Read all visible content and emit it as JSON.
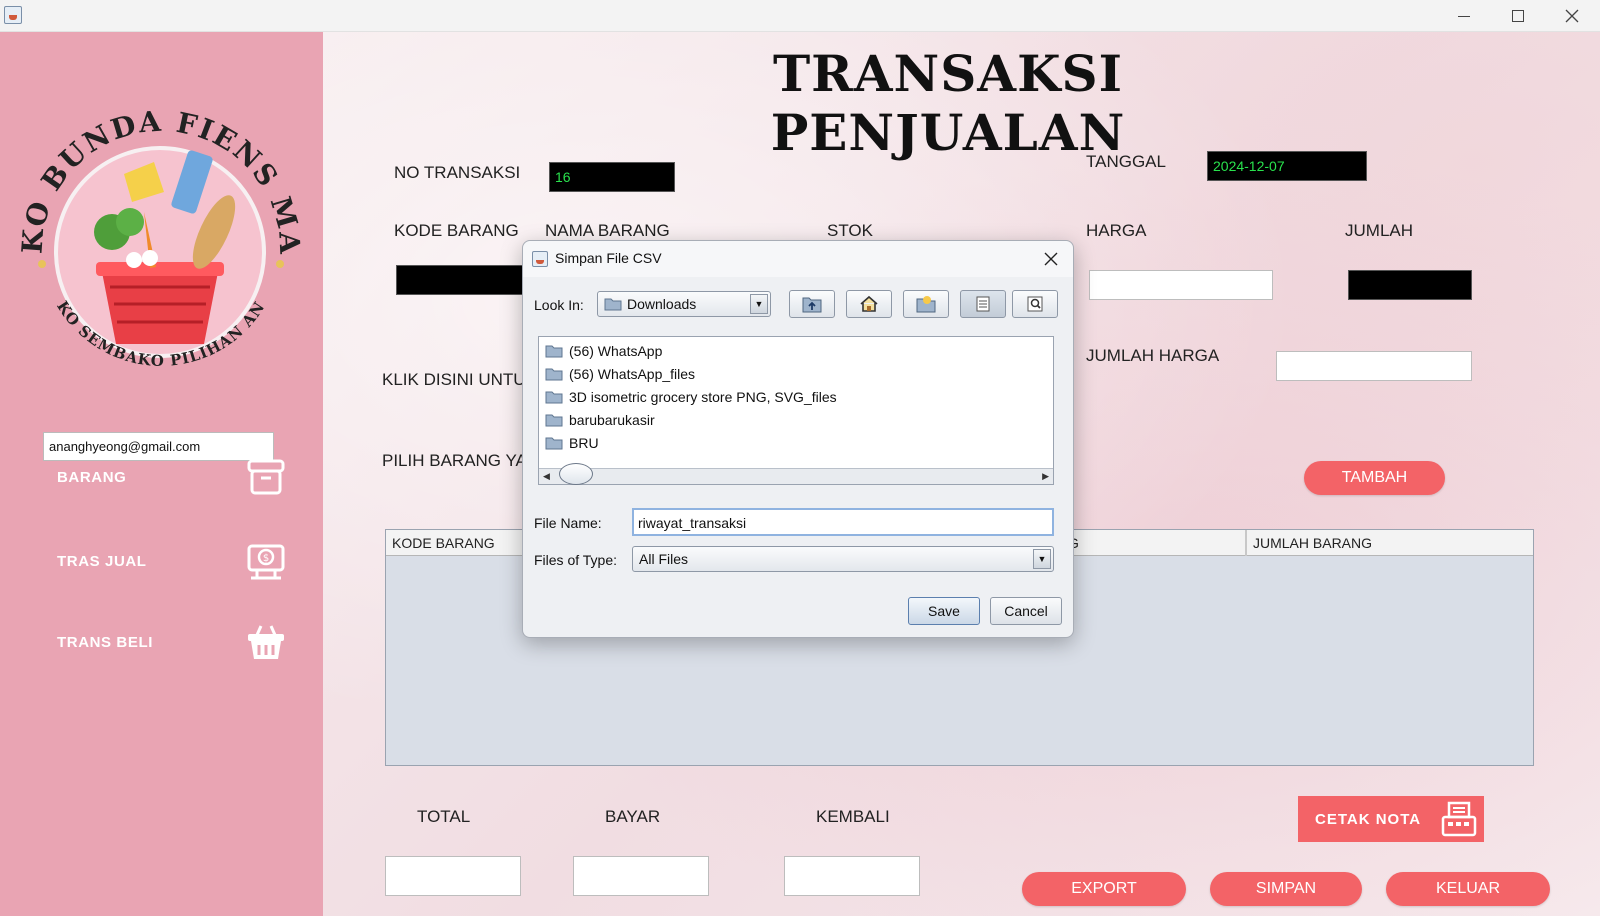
{
  "window": {
    "title": ""
  },
  "sidebar": {
    "logo": {
      "arc_top": "TOKO BUNDA FIENS MART",
      "arc_bottom": "TOKO SEMBAKO PILIHAN ANDA"
    },
    "email": "ananghyeong@gmail.com",
    "items": [
      {
        "label": "BARANG",
        "icon": "archive-box-icon"
      },
      {
        "label": "TRAS JUAL",
        "icon": "cash-register-icon"
      },
      {
        "label": "TRANS BELI",
        "icon": "shopping-basket-icon"
      }
    ]
  },
  "main": {
    "title": "TRANSAKSI PENJUALAN",
    "no_transaksi": {
      "label": "NO TRANSAKSI",
      "value": "16"
    },
    "tanggal": {
      "label": "TANGGAL",
      "value": "2024-12-07"
    },
    "kode_barang": {
      "label": "KODE BARANG",
      "value": ""
    },
    "nama_barang": {
      "label": "NAMA BARANG"
    },
    "stok": {
      "label": "STOK"
    },
    "harga": {
      "label": "HARGA",
      "value": ""
    },
    "jumlah": {
      "label": "JUMLAH",
      "value": ""
    },
    "jumlah_harga": {
      "label": "JUMLAH HARGA",
      "value": ""
    },
    "klik_label": "KLIK DISINI UNTU",
    "pilih_label": "PILIH BARANG YA",
    "tambah_label": "TAMBAH",
    "table": {
      "columns": [
        "KODE BARANG",
        "G",
        "JUMLAH BARANG"
      ],
      "rows": []
    },
    "total": {
      "label": "TOTAL",
      "value": ""
    },
    "bayar": {
      "label": "BAYAR",
      "value": ""
    },
    "kembali": {
      "label": "KEMBALI",
      "value": ""
    },
    "cetak_label": "CETAK NOTA",
    "export_label": "EXPORT",
    "simpan_label": "SIMPAN",
    "keluar_label": "KELUAR"
  },
  "dialog": {
    "title": "Simpan File CSV",
    "look_in_label": "Look In:",
    "look_in_value": "Downloads",
    "toolbar": [
      "up-folder-icon",
      "home-icon",
      "new-folder-icon",
      "list-view-icon",
      "details-view-icon"
    ],
    "files": [
      "(56) WhatsApp",
      "(56) WhatsApp_files",
      "3D isometric grocery store PNG, SVG_files",
      "barubarukasir",
      "BRU"
    ],
    "file_name_label": "File Name:",
    "file_name_value": "riwayat_transaksi",
    "files_of_type_label": "Files of Type:",
    "files_of_type_value": "All Files",
    "save_label": "Save",
    "cancel_label": "Cancel"
  },
  "colors": {
    "sidebar_bg": "#e9a4b3",
    "accent_button": "#f36367",
    "dark_field": "#000000",
    "dark_field_text": "#29e24d"
  }
}
